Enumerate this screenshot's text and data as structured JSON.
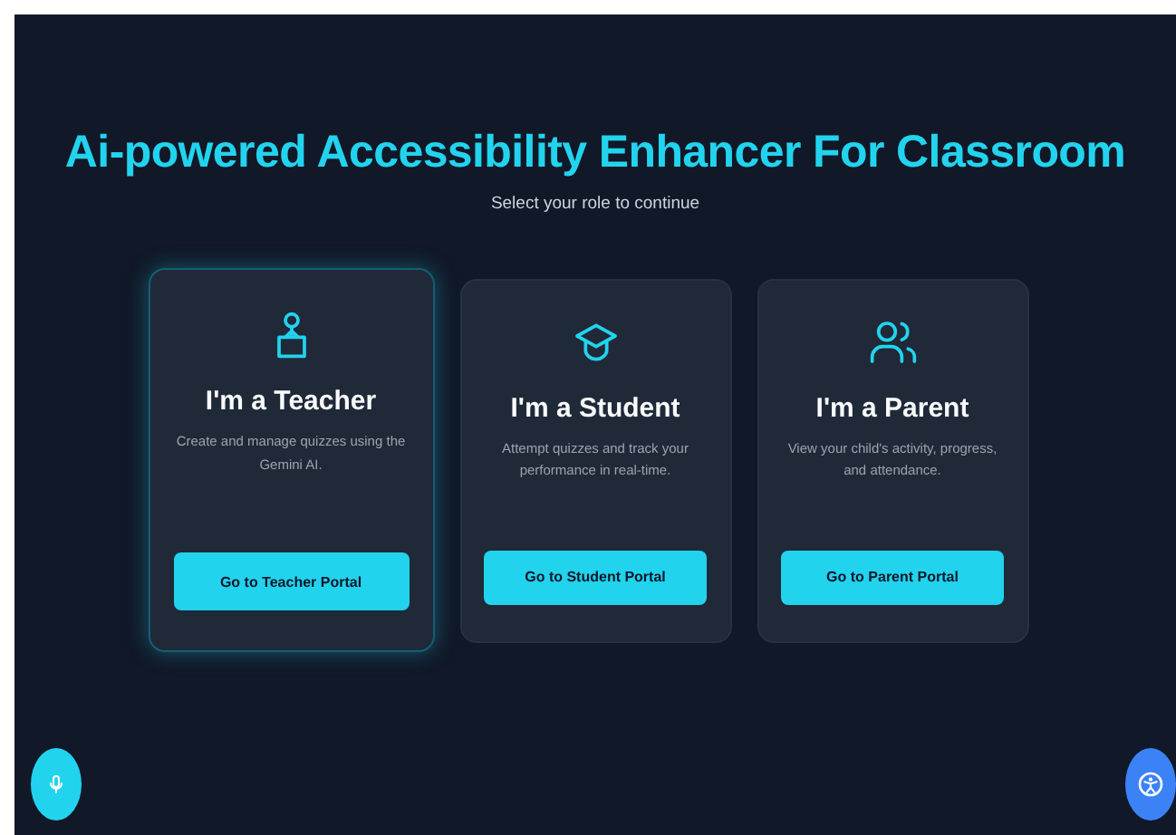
{
  "title": "Ai-powered Accessibility Enhancer For Classroom",
  "subtitle": "Select your role to continue",
  "roles": [
    {
      "kind": "teacher",
      "heading": "I'm a Teacher",
      "description": "Create and manage quizzes using the Gemini AI.",
      "button": "Go to Teacher Portal",
      "selected": true
    },
    {
      "kind": "student",
      "heading": "I'm a Student",
      "description": "Attempt quizzes and track your performance in real-time.",
      "button": "Go to Student Portal",
      "selected": false
    },
    {
      "kind": "parent",
      "heading": "I'm a Parent",
      "description": "View your child's activity, progress, and attendance.",
      "button": "Go to Parent Portal",
      "selected": false
    }
  ]
}
